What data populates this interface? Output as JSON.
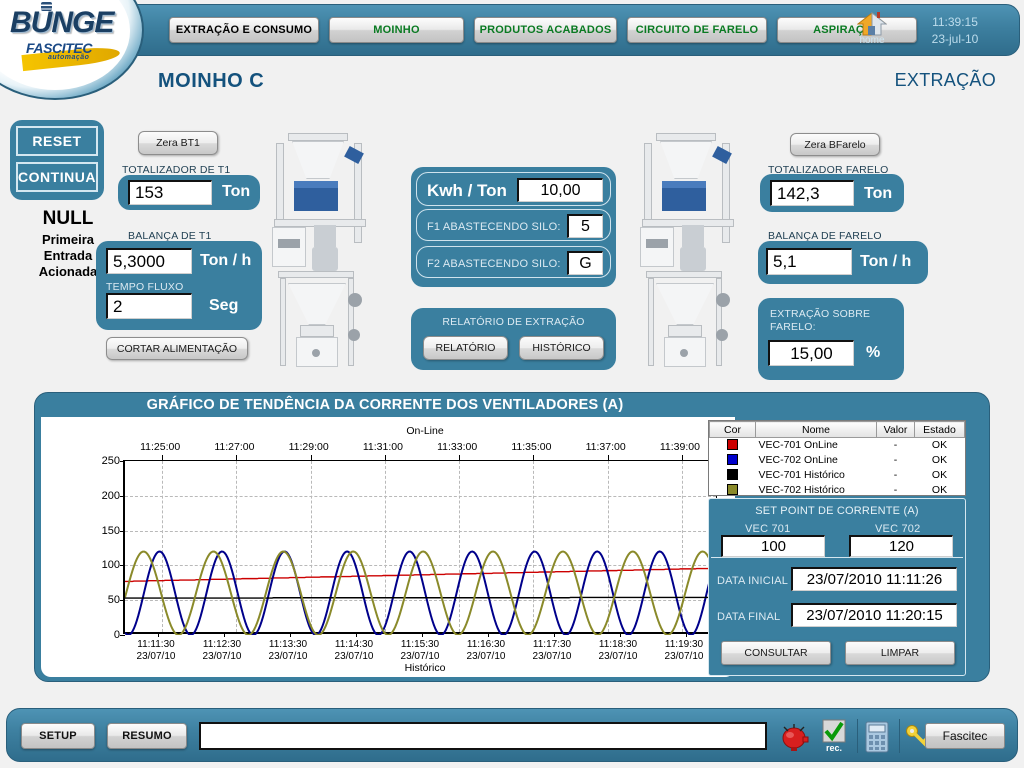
{
  "brand": {
    "name": "BUNGE",
    "vendor": "FASCITEC",
    "vendor_sub": "automação"
  },
  "topnav": {
    "items": [
      {
        "label": "EXTRAÇÃO E CONSUMO",
        "active": true
      },
      {
        "label": "MOINHO",
        "active": false
      },
      {
        "label": "PRODUTOS ACABADOS",
        "active": false
      },
      {
        "label": "CIRCUITO DE FARELO",
        "active": false
      },
      {
        "label": "ASPIRAÇÃO",
        "active": false
      }
    ],
    "home_label": "home",
    "clock_time": "11:39:15",
    "clock_date": "23-jul-10"
  },
  "header": {
    "title": "MOINHO C",
    "subtitle": "EXTRAÇÃO"
  },
  "left_controls": {
    "reset_label": "RESET",
    "continua_label": "CONTINUA",
    "status_line1": "NULL",
    "status_line2": "Primeira",
    "status_line3": "Entrada",
    "status_line4": "Acionada"
  },
  "t1": {
    "zero_button": "Zera BT1",
    "totalizer_label": "TOTALIZADOR DE T1",
    "totalizer_value": "153",
    "totalizer_unit": "Ton",
    "scale_label": "BALANÇA DE T1",
    "scale_value": "5,3000",
    "scale_unit": "Ton / h",
    "flow_label": "TEMPO FLUXO",
    "flow_value": "2",
    "flow_unit": "Seg",
    "cut_feed_button": "CORTAR ALIMENTAÇÃO"
  },
  "center": {
    "kwh_label": "Kwh / Ton",
    "kwh_value": "10,00",
    "f1_label": "F1 ABASTECENDO SILO:",
    "f1_value": "5",
    "f2_label": "F2 ABASTECENDO SILO:",
    "f2_value": "G",
    "report_title": "RELATÓRIO DE EXTRAÇÃO",
    "report_button": "RELATÓRIO",
    "history_button": "HISTÓRICO"
  },
  "farelo": {
    "zero_button": "Zera BFarelo",
    "totalizer_label": "TOTALIZADOR FARELO",
    "totalizer_value": "142,3",
    "totalizer_unit": "Ton",
    "scale_label": "BALANÇA DE FARELO",
    "scale_value": "5,1",
    "scale_unit": "Ton / h",
    "extraction_label_1": "EXTRAÇÃO SOBRE",
    "extraction_label_2": "FARELO:",
    "extraction_value": "15,00",
    "extraction_unit": "%"
  },
  "chart_panel": {
    "title": "GRÁFICO DE TENDÊNCIA DA CORRENTE DOS VENTILADORES (A)"
  },
  "legend": {
    "headers": [
      "Cor",
      "Nome",
      "Valor",
      "Estado"
    ],
    "rows": [
      {
        "color": "#cc0000",
        "name": "VEC-701 OnLine",
        "value": "-",
        "state": "OK"
      },
      {
        "color": "#0000cc",
        "name": "VEC-702 OnLine",
        "value": "-",
        "state": "OK"
      },
      {
        "color": "#000000",
        "name": "VEC-701 Histórico",
        "value": "-",
        "state": "OK"
      },
      {
        "color": "#8a8a2a",
        "name": "VEC-702 Histórico",
        "value": "-",
        "state": "OK"
      }
    ]
  },
  "setpoint": {
    "title": "SET POINT DE CORRENTE (A)",
    "vec701_label": "VEC 701",
    "vec701_value": "100",
    "vec702_label": "VEC 702",
    "vec702_value": "120",
    "data_inicial_label": "DATA INICIAL",
    "data_inicial_value": "23/07/2010 11:11:26",
    "data_final_label": "DATA FINAL",
    "data_final_value": "23/07/2010 11:20:15",
    "consult_button": "CONSULTAR",
    "clear_button": "LIMPAR"
  },
  "bottombar": {
    "setup_label": "SETUP",
    "resumo_label": "RESUMO",
    "message_value": "",
    "rec_label": "rec.",
    "fascitec_label": "Fascitec"
  },
  "chart_data": {
    "type": "line",
    "title": "GRÁFICO DE TENDÊNCIA DA CORRENTE DOS VENTILADORES (A)",
    "xlabel_top": "On-Line",
    "xlabel_bottom": "Histórico",
    "ylabel": "",
    "ylim": [
      0,
      250
    ],
    "yticks": [
      0,
      50,
      100,
      150,
      200,
      250
    ],
    "grid": true,
    "legend_position": "right",
    "x_top_ticks": [
      "11:25:00",
      "11:27:00",
      "11:29:00",
      "11:31:00",
      "11:33:00",
      "11:35:00",
      "11:37:00",
      "11:39:00"
    ],
    "x_bottom_ticks": [
      {
        "time": "11:11:30",
        "date": "23/07/10"
      },
      {
        "time": "11:12:30",
        "date": "23/07/10"
      },
      {
        "time": "11:13:30",
        "date": "23/07/10"
      },
      {
        "time": "11:14:30",
        "date": "23/07/10"
      },
      {
        "time": "11:15:30",
        "date": "23/07/10"
      },
      {
        "time": "11:16:30",
        "date": "23/07/10"
      },
      {
        "time": "11:17:30",
        "date": "23/07/10"
      },
      {
        "time": "11:18:30",
        "date": "23/07/10"
      },
      {
        "time": "11:19:30",
        "date": "23/07/10"
      }
    ],
    "series": [
      {
        "name": "VEC-701 OnLine",
        "color": "#cc0000",
        "kind": "ramp",
        "y_start": 77,
        "y_end": 96
      },
      {
        "name": "VEC-702 OnLine",
        "color": "#00008b",
        "kind": "sine",
        "amplitude": 60,
        "offset": 60,
        "periods": 9.5,
        "phase": -1.9
      },
      {
        "name": "VEC-701 Histórico",
        "color": "#000000",
        "kind": "ramp",
        "y_start": 53,
        "y_end": 54
      },
      {
        "name": "VEC-702 Histórico",
        "color": "#8a8a2a",
        "kind": "sine",
        "amplitude": 60,
        "offset": 60,
        "periods": 8.5,
        "phase": -0.1
      }
    ]
  }
}
